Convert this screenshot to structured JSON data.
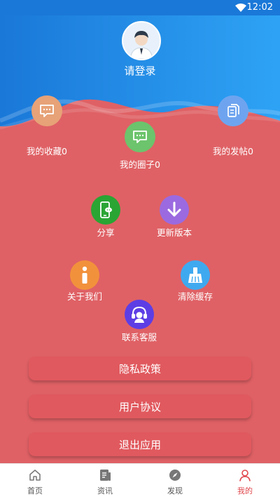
{
  "status_bar": {
    "time": "12:02"
  },
  "profile": {
    "login_text": "请登录"
  },
  "stats": {
    "favorites": "我的收藏0",
    "circle": "我的圈子0",
    "posts": "我的发帖0"
  },
  "menu": {
    "share": "分享",
    "update": "更新版本",
    "about": "关于我们",
    "clear_cache": "清除缓存",
    "contact": "联系客服"
  },
  "buttons": {
    "privacy": "隐私政策",
    "agreement": "用户协议",
    "exit": "退出应用"
  },
  "tabbar": {
    "items": [
      "首页",
      "资讯",
      "发现",
      "我的"
    ],
    "active_index": 3,
    "active_color": "#e0484d"
  },
  "colors": {
    "header_blue": "#1a8ae8",
    "background": "#df6165",
    "favorites_icon": "#e7a277",
    "circle_icon": "#6cc46c",
    "posts_icon": "#6ea4ef",
    "share_icon": "#2aa534",
    "update_icon": "#9b6ae0",
    "about_icon": "#f2913c",
    "clear_icon": "#3fa9f0",
    "contact_icon": "#5d3ee5"
  }
}
